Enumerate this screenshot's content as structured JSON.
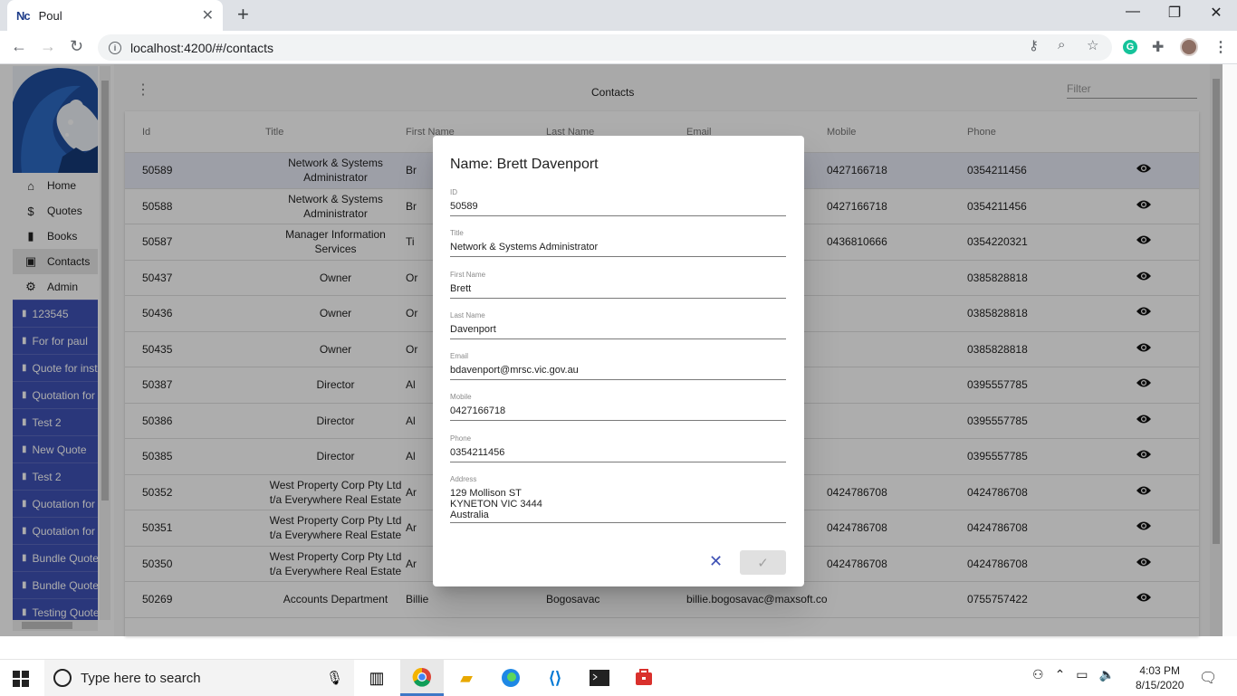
{
  "browser": {
    "tab_favicon": "Nc",
    "tab_title": "Poul",
    "tab_close": "✕",
    "new_tab": "+",
    "url": "localhost:4200/#/contacts",
    "window_controls": [
      "—",
      "❐",
      "✕"
    ]
  },
  "sidebar": {
    "nav": [
      {
        "label": "Home",
        "icon": "home-icon"
      },
      {
        "label": "Quotes",
        "icon": "dollar-doc-icon"
      },
      {
        "label": "Books",
        "icon": "book-icon"
      },
      {
        "label": "Contacts",
        "icon": "contact-icon"
      },
      {
        "label": "Admin",
        "icon": "gear-icon"
      }
    ],
    "quotes": [
      "123545",
      "For for paul",
      "Quote for insta",
      "Quotation for c",
      "Test 2",
      "New Quote",
      "Test 2",
      "Quotation for c",
      "Quotation for c",
      "Bundle Quote",
      "Bundle Quote",
      "Testing Quote"
    ]
  },
  "page": {
    "title": "Contacts",
    "filter_placeholder": "Filter"
  },
  "table": {
    "columns": [
      "Id",
      "Title",
      "First Name",
      "Last Name",
      "Email",
      "Mobile",
      "Phone",
      ""
    ],
    "rows": [
      {
        "id": "50589",
        "title": "Network & Systems Administrator",
        "first": "Br",
        "last": "",
        "email": ".gov.au",
        "mobile": "0427166718",
        "phone": "0354211456"
      },
      {
        "id": "50588",
        "title": "Network & Systems Administrator",
        "first": "Br",
        "last": "",
        "email": ".gov.au",
        "mobile": "0427166718",
        "phone": "0354211456"
      },
      {
        "id": "50587",
        "title": "Manager Information Services",
        "first": "Ti",
        "last": "",
        "email": ".gov.au",
        "mobile": "0436810666",
        "phone": "0354220321"
      },
      {
        "id": "50437",
        "title": "Owner",
        "first": "Or",
        "last": "",
        "email": "que.com",
        "mobile": "",
        "phone": "0385828818"
      },
      {
        "id": "50436",
        "title": "Owner",
        "first": "Or",
        "last": "",
        "email": "que.com",
        "mobile": "",
        "phone": "0385828818"
      },
      {
        "id": "50435",
        "title": "Owner",
        "first": "Or",
        "last": "",
        "email": "que.com",
        "mobile": "",
        "phone": "0385828818"
      },
      {
        "id": "50387",
        "title": "Director",
        "first": "Al",
        "last": "",
        "email": "s.com.au",
        "mobile": "",
        "phone": "0395557785"
      },
      {
        "id": "50386",
        "title": "Director",
        "first": "Al",
        "last": "",
        "email": "s.com.au",
        "mobile": "",
        "phone": "0395557785"
      },
      {
        "id": "50385",
        "title": "Director",
        "first": "Al",
        "last": "",
        "email": "s.com.au",
        "mobile": "",
        "phone": "0395557785"
      },
      {
        "id": "50352",
        "title": "West Property Corp Pty Ltd t/a Everywhere Real Estate",
        "first": "Ar",
        "last": "",
        "email": "ertygroup",
        "mobile": "0424786708",
        "phone": "0424786708"
      },
      {
        "id": "50351",
        "title": "West Property Corp Pty Ltd t/a Everywhere Real Estate",
        "first": "Ar",
        "last": "",
        "email": "ertygroup",
        "mobile": "0424786708",
        "phone": "0424786708"
      },
      {
        "id": "50350",
        "title": "West Property Corp Pty Ltd t/a Everywhere Real Estate",
        "first": "Ar",
        "last": "",
        "email": "ertygroup",
        "mobile": "0424786708",
        "phone": "0424786708"
      },
      {
        "id": "50269",
        "title": "Accounts Department",
        "first": "Billie",
        "last": "Bogosavac",
        "email": "billie.bogosavac@maxsoft.com",
        "mobile": "",
        "phone": "0755757422"
      }
    ]
  },
  "dialog": {
    "title": "Name: Brett Davenport",
    "fields": [
      {
        "label": "ID",
        "value": "50589"
      },
      {
        "label": "Title",
        "value": "Network & Systems Administrator"
      },
      {
        "label": "First Name",
        "value": "Brett"
      },
      {
        "label": "Last Name",
        "value": "Davenport"
      },
      {
        "label": "Email",
        "value": "bdavenport@mrsc.vic.gov.au"
      },
      {
        "label": "Mobile",
        "value": "0427166718"
      },
      {
        "label": "Phone",
        "value": "0354211456"
      },
      {
        "label": "Address",
        "value": "129 Mollison ST\nKYNETON VIC 3444\nAustralia"
      }
    ],
    "close_icon": "✕",
    "confirm_icon": "✓"
  },
  "taskbar": {
    "search_placeholder": "Type here to search",
    "time": "4:03 PM",
    "date": "8/15/2020"
  }
}
